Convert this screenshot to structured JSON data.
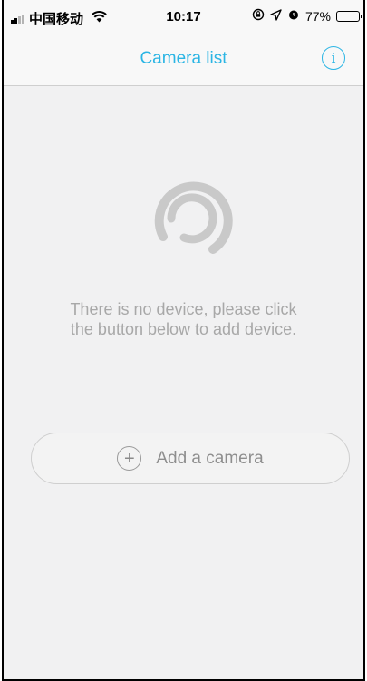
{
  "status_bar": {
    "carrier": "中国移动",
    "time": "10:17",
    "battery_percent": "77%",
    "battery_level": 0.77
  },
  "nav": {
    "title": "Camera list",
    "info_icon": "info-icon"
  },
  "empty_state": {
    "icon": "camera-ring-logo-icon",
    "message": "There is no device, please click the button below to add device."
  },
  "add_button": {
    "label": "Add a camera",
    "icon": "plus-circle-icon"
  },
  "colors": {
    "accent": "#2bb5e4",
    "muted_text": "#a8a8a8",
    "background": "#f1f1f2"
  }
}
